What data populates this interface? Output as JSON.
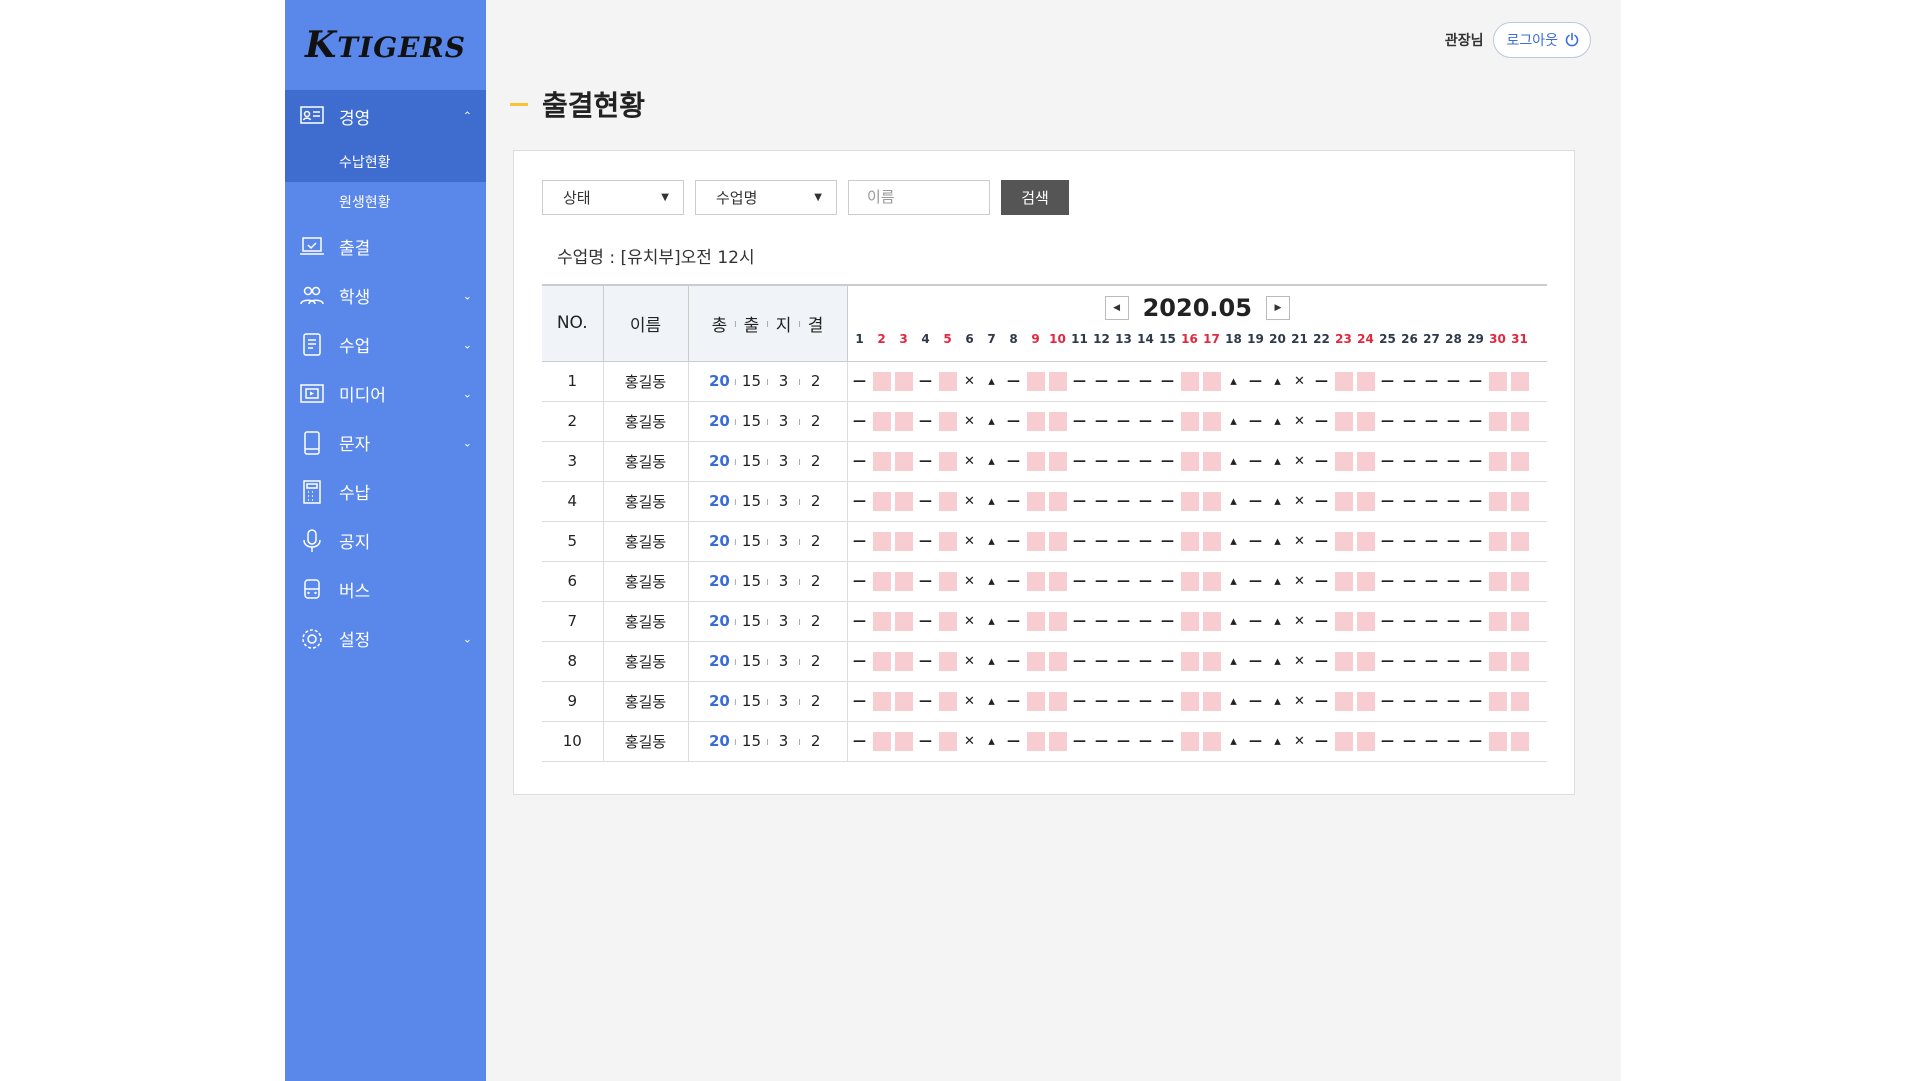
{
  "logo": {
    "k": "K",
    "rest": "TIGERS"
  },
  "sidebar": {
    "items": [
      {
        "label": "경영",
        "icon": "id-card-icon",
        "expanded": true,
        "children": [
          {
            "label": "수납현황",
            "active": true
          },
          {
            "label": "원생현황",
            "active": false
          }
        ]
      },
      {
        "label": "출결",
        "icon": "laptop-icon"
      },
      {
        "label": "학생",
        "icon": "users-icon",
        "has_children": true
      },
      {
        "label": "수업",
        "icon": "document-icon",
        "has_children": true
      },
      {
        "label": "미디어",
        "icon": "media-icon",
        "has_children": true
      },
      {
        "label": "문자",
        "icon": "phone-icon",
        "has_children": true
      },
      {
        "label": "수납",
        "icon": "calculator-icon"
      },
      {
        "label": "공지",
        "icon": "microphone-icon"
      },
      {
        "label": "버스",
        "icon": "bus-icon"
      },
      {
        "label": "설정",
        "icon": "gear-icon",
        "has_children": true
      }
    ]
  },
  "header": {
    "user": "관장님",
    "logout": "로그아웃"
  },
  "page": {
    "title": "출결현황"
  },
  "filters": {
    "status": "상태",
    "class": "수업명",
    "name_placeholder": "이름",
    "search": "검색"
  },
  "class_label": "수업명 : [유치부]오전 12시",
  "table": {
    "headers": {
      "no": "NO.",
      "name": "이름",
      "stats": [
        "총",
        "출",
        "지",
        "결"
      ]
    },
    "month": "2020.05",
    "days": [
      {
        "d": "1",
        "red": false
      },
      {
        "d": "2",
        "red": true
      },
      {
        "d": "3",
        "red": true
      },
      {
        "d": "4",
        "red": false
      },
      {
        "d": "5",
        "red": true
      },
      {
        "d": "6",
        "red": false
      },
      {
        "d": "7",
        "red": false
      },
      {
        "d": "8",
        "red": false
      },
      {
        "d": "9",
        "red": true
      },
      {
        "d": "10",
        "red": true
      },
      {
        "d": "11",
        "red": false
      },
      {
        "d": "12",
        "red": false
      },
      {
        "d": "13",
        "red": false
      },
      {
        "d": "14",
        "red": false
      },
      {
        "d": "15",
        "red": false
      },
      {
        "d": "16",
        "red": true
      },
      {
        "d": "17",
        "red": true
      },
      {
        "d": "18",
        "red": false
      },
      {
        "d": "19",
        "red": false
      },
      {
        "d": "20",
        "red": false
      },
      {
        "d": "21",
        "red": false
      },
      {
        "d": "22",
        "red": false
      },
      {
        "d": "23",
        "red": true
      },
      {
        "d": "24",
        "red": true
      },
      {
        "d": "25",
        "red": false
      },
      {
        "d": "26",
        "red": false
      },
      {
        "d": "27",
        "red": false
      },
      {
        "d": "28",
        "red": false
      },
      {
        "d": "29",
        "red": false
      },
      {
        "d": "30",
        "red": true
      },
      {
        "d": "31",
        "red": true
      }
    ],
    "attendance_pattern": [
      "—",
      "",
      "",
      "—",
      "",
      "✕",
      "▴",
      "—",
      "",
      "",
      "—",
      "—",
      "—",
      "—",
      "—",
      "",
      "",
      "▴",
      "—",
      "▴",
      "✕",
      "—",
      "",
      "",
      "—",
      "—",
      "—",
      "—",
      "—",
      "",
      ""
    ],
    "rows": [
      {
        "no": "1",
        "name": "홍길동",
        "total": "20",
        "present": "15",
        "late": "3",
        "absent": "2"
      },
      {
        "no": "2",
        "name": "홍길동",
        "total": "20",
        "present": "15",
        "late": "3",
        "absent": "2"
      },
      {
        "no": "3",
        "name": "홍길동",
        "total": "20",
        "present": "15",
        "late": "3",
        "absent": "2"
      },
      {
        "no": "4",
        "name": "홍길동",
        "total": "20",
        "present": "15",
        "late": "3",
        "absent": "2"
      },
      {
        "no": "5",
        "name": "홍길동",
        "total": "20",
        "present": "15",
        "late": "3",
        "absent": "2"
      },
      {
        "no": "6",
        "name": "홍길동",
        "total": "20",
        "present": "15",
        "late": "3",
        "absent": "2"
      },
      {
        "no": "7",
        "name": "홍길동",
        "total": "20",
        "present": "15",
        "late": "3",
        "absent": "2"
      },
      {
        "no": "8",
        "name": "홍길동",
        "total": "20",
        "present": "15",
        "late": "3",
        "absent": "2"
      },
      {
        "no": "9",
        "name": "홍길동",
        "total": "20",
        "present": "15",
        "late": "3",
        "absent": "2"
      },
      {
        "no": "10",
        "name": "홍길동",
        "total": "20",
        "present": "15",
        "late": "3",
        "absent": "2"
      }
    ]
  },
  "colors": {
    "sidebar": "#5987ea",
    "sidebar_active": "#3f6ccf",
    "accent": "#f7c233",
    "total": "#3b6dd8",
    "off_day": "#f8cdd2",
    "weekend_text": "#e0283e"
  }
}
